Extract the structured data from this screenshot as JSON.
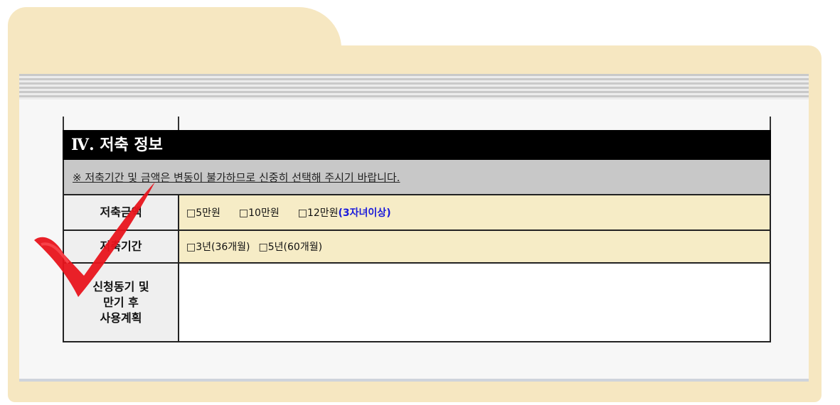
{
  "section": {
    "title": "Ⅳ. 저축 정보",
    "notice": "※ 저축기간 및 금액은 변동이 불가하므로 신중히 선택해 주시기 바랍니다."
  },
  "rows": [
    {
      "label": "저축금액",
      "options": [
        {
          "box": "□",
          "text": "5만원"
        },
        {
          "box": "□",
          "text": "10만원"
        },
        {
          "box": "□",
          "text": "12만원",
          "note": "(3자녀이상)"
        }
      ]
    },
    {
      "label": "저축기간",
      "options": [
        {
          "box": "□",
          "text": "3년(36개월)"
        },
        {
          "box": "□",
          "text": "5년(60개월)"
        }
      ]
    },
    {
      "label_lines": [
        "신청동기 및",
        "만기 후",
        "사용계획"
      ],
      "value": ""
    }
  ],
  "colors": {
    "folder": "#f6e7c1",
    "header_bg": "#000000",
    "notice_bg": "#c8c8c8",
    "option_bg": "#f6ecc6",
    "note_text": "#1a1adb",
    "checkmark": "#e8141c"
  },
  "decoration": {
    "icon": "red-checkmark-icon"
  }
}
